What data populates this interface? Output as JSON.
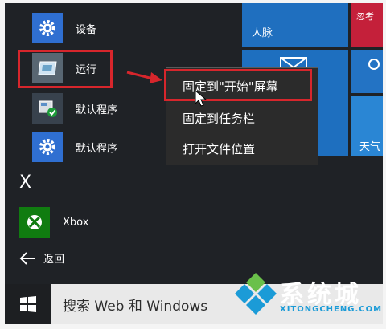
{
  "start_menu": {
    "apps": [
      {
        "label": "设备",
        "icon": "gear-icon"
      },
      {
        "label": "运行",
        "icon": "run-icon"
      },
      {
        "label": "默认程序",
        "icon": "default-programs-icon"
      },
      {
        "label": "默认程序",
        "icon": "gear-icon"
      }
    ],
    "section_letter": "X",
    "xbox": {
      "label": "Xbox",
      "icon": "xbox-icon"
    },
    "back": {
      "label": "返回",
      "icon": "back-arrow-icon"
    }
  },
  "tiles": {
    "people_label": "人脉",
    "top_right_label": "忽考",
    "weather_label": "天气"
  },
  "context_menu": {
    "items": [
      "固定到\"开始\"屏幕",
      "固定到任务栏",
      "打开文件位置"
    ],
    "highlighted_index": 0
  },
  "taskbar": {
    "search_text": "搜索 Web 和 Windows"
  },
  "watermark": {
    "title": "系统城",
    "url": "XITONGCHENG.COM"
  },
  "colors": {
    "background": "#1f2226",
    "annotation_red": "#d7262c",
    "tile_blue": "#1e6fbf",
    "tile_red": "#c4203a",
    "xbox_green": "#107c10"
  }
}
